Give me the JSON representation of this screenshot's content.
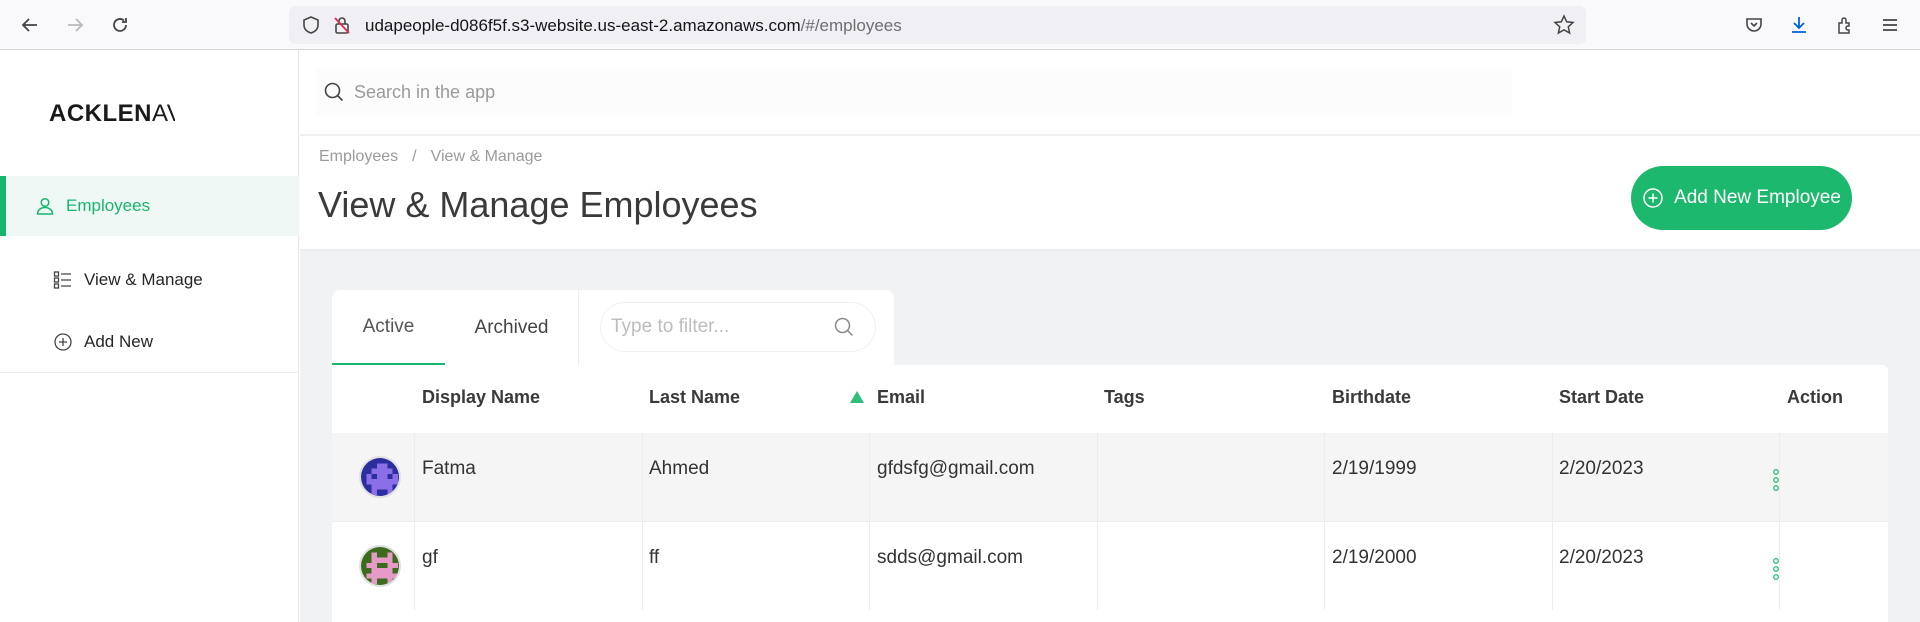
{
  "browser": {
    "url_host": "udapeople-d086f5f.s3-website.us-east-2.amazonaws.com",
    "url_path": "/#/employees"
  },
  "sidebar": {
    "logo": "ACKLENAV",
    "logo_bold": "ACKLEN",
    "logo_tail": "AV",
    "items": [
      {
        "label": "Employees",
        "icon": "user-icon",
        "active": true
      },
      {
        "label": "View & Manage",
        "icon": "list-icon",
        "active": false
      },
      {
        "label": "Add New",
        "icon": "plus-circle-icon",
        "active": false
      }
    ]
  },
  "search": {
    "placeholder": "Search in the app"
  },
  "breadcrumb": {
    "items": [
      "Employees",
      "View & Manage"
    ],
    "separator": "/"
  },
  "page": {
    "title": "View & Manage Employees"
  },
  "actions": {
    "add_label": "Add New Employee"
  },
  "tabs": [
    {
      "label": "Active",
      "active": true
    },
    {
      "label": "Archived",
      "active": false
    }
  ],
  "filter": {
    "placeholder": "Type to filter..."
  },
  "table": {
    "columns": [
      "Display Name",
      "Last Name",
      "Email",
      "Tags",
      "Birthdate",
      "Start Date",
      "Action"
    ],
    "sort": {
      "column": "Last Name",
      "direction": "ascending"
    },
    "rows": [
      {
        "display_name": "Fatma",
        "last_name": "Ahmed",
        "email": "gfdsfg@gmail.com",
        "tags": "",
        "birthdate": "2/19/1999",
        "start_date": "2/20/2023"
      },
      {
        "display_name": "gf",
        "last_name": "ff",
        "email": "sdds@gmail.com",
        "tags": "",
        "birthdate": "2/19/2000",
        "start_date": "2/20/2023"
      }
    ]
  },
  "colors": {
    "accent": "#1cb86d",
    "active_bg": "#f0f8f5",
    "page_bg": "#f0f2f3"
  }
}
